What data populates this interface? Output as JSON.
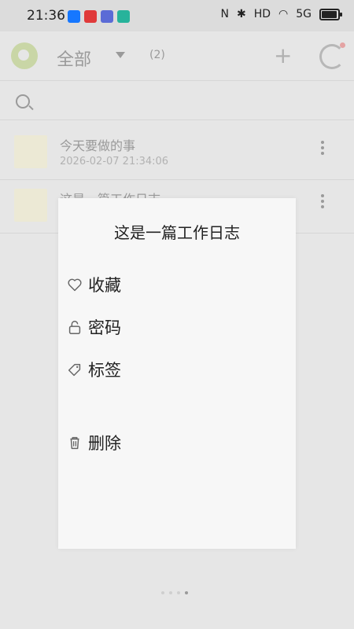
{
  "status_bar": {
    "time": "21:36",
    "signal_text": "5G"
  },
  "header": {
    "folder_title": "全部",
    "count": "(2)",
    "add_icon": "plus-icon",
    "sync_icon": "sync-icon"
  },
  "search": {
    "icon": "search-icon"
  },
  "notes": [
    {
      "title": "今天要做的事",
      "time": "2026-02-07 21:34:06"
    },
    {
      "title": "这是一篇工作日志",
      "time": ""
    }
  ],
  "dialog": {
    "title": "这是一篇工作日志",
    "items": [
      {
        "label": "收藏",
        "icon": "heart-icon"
      },
      {
        "label": "密码",
        "icon": "lock-icon"
      },
      {
        "label": "标签",
        "icon": "tag-icon"
      },
      {
        "label": "删除",
        "icon": "trash-icon"
      }
    ]
  },
  "colors": {
    "dim_background": "#e6e6e6",
    "dialog_background": "#f7f7f7",
    "text_primary": "#222222",
    "text_dimmed": "#9a9a9a"
  }
}
